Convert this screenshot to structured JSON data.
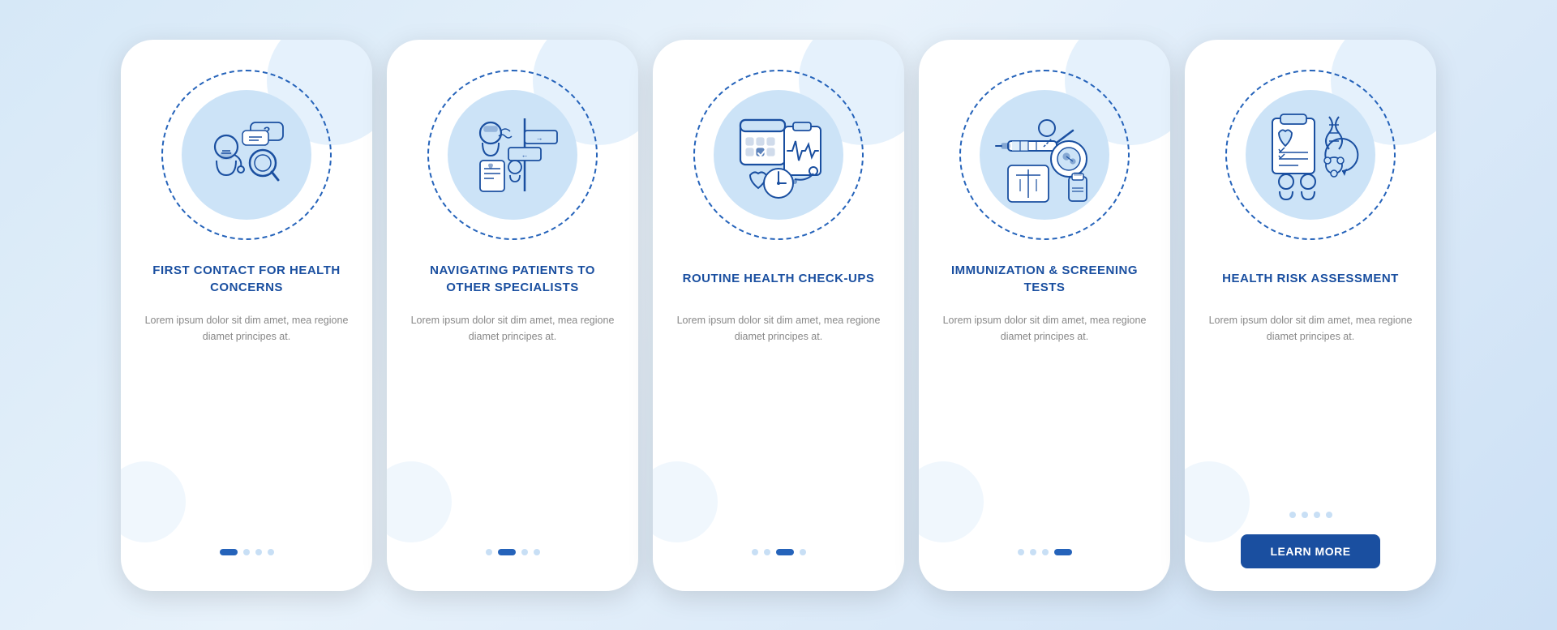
{
  "colors": {
    "accent": "#1a4fa0",
    "light_blue": "#cce3f7",
    "dashed_border": "#2563ba",
    "dot_active": "#2563ba",
    "dot_inactive": "#c8dff5",
    "text_title": "#1a4fa0",
    "text_desc": "#888",
    "btn_bg": "#1a4fa0",
    "btn_text": "#ffffff"
  },
  "cards": [
    {
      "id": "card-1",
      "title": "FIRST CONTACT FOR HEALTH CONCERNS",
      "description": "Lorem ipsum dolor sit dim amet, mea regione diamet principes at.",
      "dots": [
        true,
        false,
        false,
        false
      ],
      "active_dot": 0,
      "show_button": false,
      "button_label": ""
    },
    {
      "id": "card-2",
      "title": "NAVIGATING PATIENTS TO OTHER SPECIALISTS",
      "description": "Lorem ipsum dolor sit dim amet, mea regione diamet principes at.",
      "dots": [
        false,
        true,
        false,
        false
      ],
      "active_dot": 1,
      "show_button": false,
      "button_label": ""
    },
    {
      "id": "card-3",
      "title": "ROUTINE HEALTH CHECK-UPS",
      "description": "Lorem ipsum dolor sit dim amet, mea regione diamet principes at.",
      "dots": [
        false,
        false,
        true,
        false
      ],
      "active_dot": 2,
      "show_button": false,
      "button_label": ""
    },
    {
      "id": "card-4",
      "title": "IMMUNIZATION & SCREENING TESTS",
      "description": "Lorem ipsum dolor sit dim amet, mea regione diamet principes at.",
      "dots": [
        false,
        false,
        false,
        true
      ],
      "active_dot": 3,
      "show_button": false,
      "button_label": ""
    },
    {
      "id": "card-5",
      "title": "HEALTH RISK ASSESSMENT",
      "description": "Lorem ipsum dolor sit dim amet, mea regione diamet principes at.",
      "dots": [
        false,
        false,
        false,
        false
      ],
      "active_dot": -1,
      "show_button": true,
      "button_label": "LEARN MORE"
    }
  ]
}
